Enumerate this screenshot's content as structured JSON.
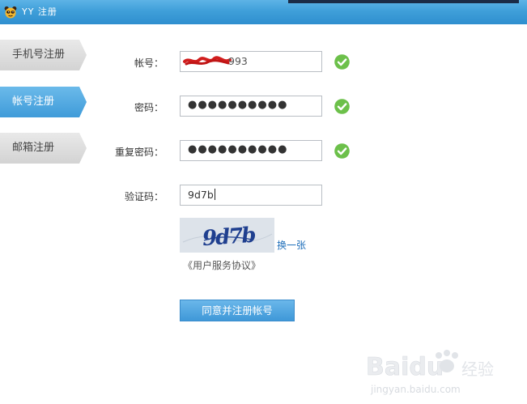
{
  "window": {
    "title": "YY 注册",
    "app_icon": "bear-face-icon"
  },
  "sidebar": {
    "tabs": [
      {
        "label": "手机号注册",
        "active": false
      },
      {
        "label": "帐号注册",
        "active": true
      },
      {
        "label": "邮箱注册",
        "active": false
      }
    ]
  },
  "form": {
    "account": {
      "label": "帐号：",
      "value": "993",
      "valid": true
    },
    "password": {
      "label": "密码：",
      "value": "●●●●●●●●●●",
      "valid": true
    },
    "confirm_password": {
      "label": "重复密码：",
      "value": "●●●●●●●●●●",
      "valid": true
    },
    "captcha": {
      "label": "验证码：",
      "value": "9d7b",
      "image_text": "9d7b"
    },
    "refresh_captcha_label": "换一张",
    "agreement_link": "《用户服务协议》",
    "submit_label": "同意并注册帐号"
  },
  "watermark": {
    "brand": "Baidu",
    "label": "经验",
    "url": "jingyan.baidu.com"
  },
  "colors": {
    "titlebar": "#3f9fd9",
    "active_tab": "#4da7df",
    "inactive_tab": "#dcdcdc",
    "valid_check": "#6cc04a",
    "link": "#1f6fba",
    "button": "#4a9fdc"
  }
}
